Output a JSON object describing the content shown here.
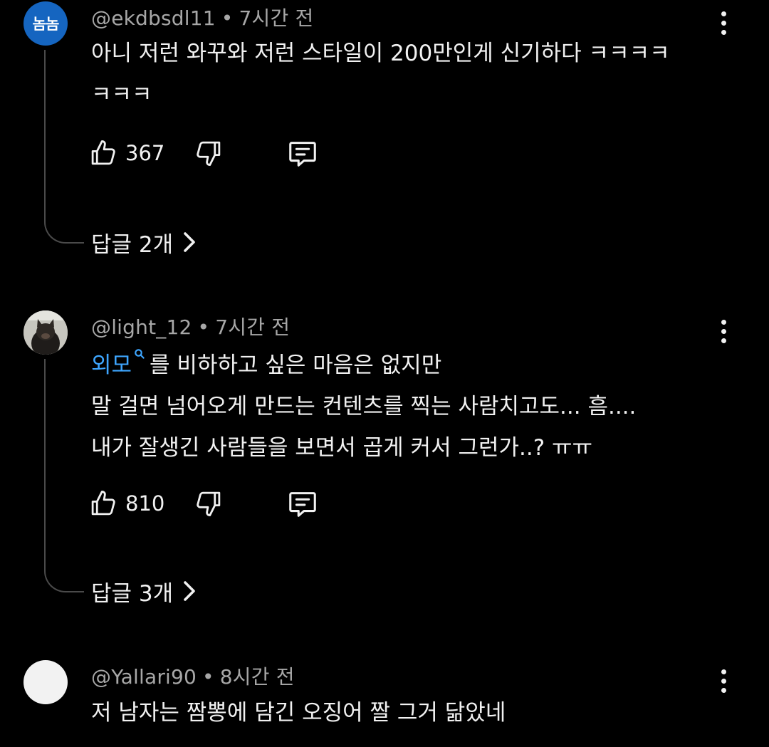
{
  "comments": [
    {
      "avatar_text": "놈놈",
      "author": "@ekdbsdl11",
      "time": "7시간 전",
      "lines": [
        "아니 저런 와꾸와 저런 스타일이 200만인게 신기하다 ㅋㅋㅋㅋ",
        "ㅋㅋㅋ"
      ],
      "likes": "367",
      "replies_label": "답글 2개"
    },
    {
      "avatar_icon": "cat-photo-avatar",
      "author": "@light_12",
      "time": "7시간 전",
      "link_word": "외모",
      "line1_rest": "를 비하하고 싶은 마음은 없지만",
      "lines": [
        "말 걸면 넘어오게 만드는 컨텐츠를 찍는 사람치고도... 흠....",
        "내가 잘생긴 사람들을 보면서 곱게 커서 그런가..? ㅠㅠ"
      ],
      "likes": "810",
      "replies_label": "답글 3개"
    },
    {
      "author": "@Yallari90",
      "time": "8시간 전",
      "lines": [
        "저 남자는 짬뽕에 담긴 오징어 짤 그거 닮았네"
      ]
    }
  ],
  "separator": "•",
  "icons": [
    "like-icon",
    "dislike-icon",
    "reply-icon",
    "more-options-icon",
    "chevron-right-icon",
    "search-icon"
  ],
  "colors": {
    "background": "#000000",
    "text": "#f1f1f1",
    "meta": "#a7a7a7",
    "link": "#3ea6ff",
    "avatar_blue": "#1565c0"
  }
}
